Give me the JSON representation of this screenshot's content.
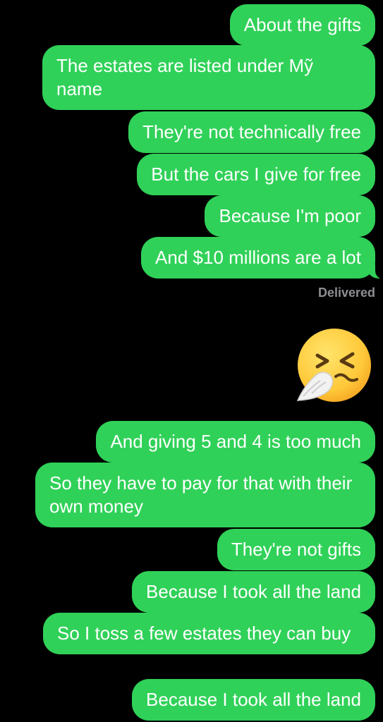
{
  "messages": [
    {
      "text": "About the gifts"
    },
    {
      "text": "The estates are listed under Mỹ name"
    },
    {
      "text": "They're not technically free"
    },
    {
      "text": "But the cars I give for free"
    },
    {
      "text": "Because I'm poor"
    },
    {
      "text": "And $10 millions are a lot"
    },
    {
      "text": "And giving 5 and 4 is too much"
    },
    {
      "text": "So they have to pay for that with their own money"
    },
    {
      "text": "They're not gifts"
    },
    {
      "text": "Because I took all the land"
    },
    {
      "text": "So I toss a few estates they can buy"
    },
    {
      "text": "Because I took all the land"
    }
  ],
  "status": "Delivered",
  "emoji": "sneezing-face",
  "colors": {
    "bubble": "#30d158",
    "background": "#000000",
    "status": "#8e8e93"
  }
}
